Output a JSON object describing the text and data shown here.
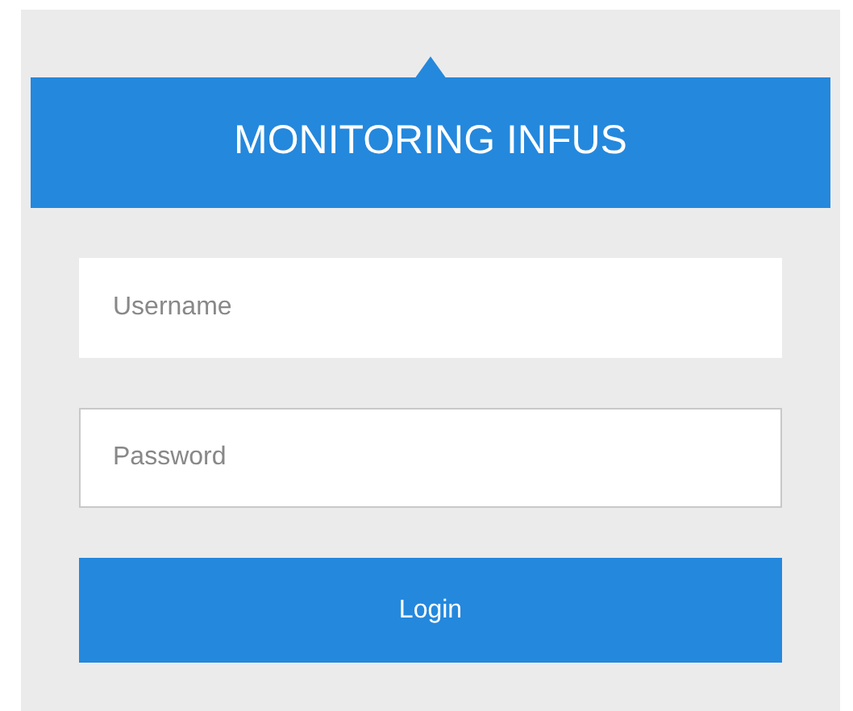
{
  "header": {
    "title": "MONITORING INFUS"
  },
  "fields": [
    {
      "placeholder": "Username",
      "focused": false
    },
    {
      "placeholder": "Password",
      "focused": true
    }
  ],
  "login_button": {
    "label": "Login"
  }
}
